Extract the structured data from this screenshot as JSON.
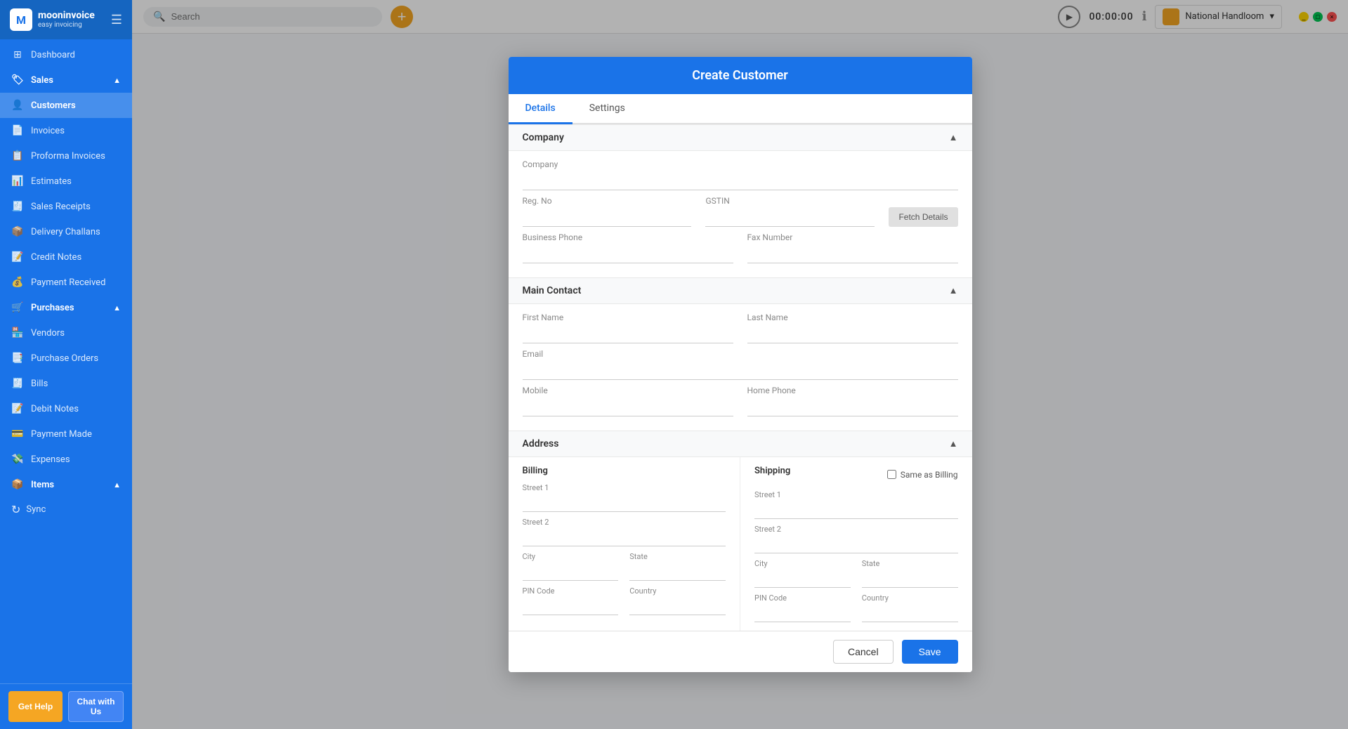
{
  "app": {
    "name": "mooninvoice",
    "tagline": "easy invoicing"
  },
  "topbar": {
    "search_placeholder": "Search",
    "timer": "00:00:00",
    "company": "National Handloom"
  },
  "sidebar": {
    "items": [
      {
        "id": "dashboard",
        "label": "Dashboard",
        "icon": "⊞",
        "active": false,
        "section": false
      },
      {
        "id": "sales",
        "label": "Sales",
        "icon": "🏷",
        "active": false,
        "section": true,
        "expanded": true
      },
      {
        "id": "customers",
        "label": "Customers",
        "icon": "👤",
        "active": true,
        "section": false
      },
      {
        "id": "invoices",
        "label": "Invoices",
        "icon": "📄",
        "active": false,
        "section": false
      },
      {
        "id": "proforma-invoices",
        "label": "Proforma Invoices",
        "icon": "📋",
        "active": false,
        "section": false
      },
      {
        "id": "estimates",
        "label": "Estimates",
        "icon": "📊",
        "active": false,
        "section": false
      },
      {
        "id": "sales-receipts",
        "label": "Sales Receipts",
        "icon": "🧾",
        "active": false,
        "section": false
      },
      {
        "id": "delivery-challans",
        "label": "Delivery Challans",
        "icon": "📦",
        "active": false,
        "section": false
      },
      {
        "id": "credit-notes",
        "label": "Credit Notes",
        "icon": "📝",
        "active": false,
        "section": false
      },
      {
        "id": "payment-received",
        "label": "Payment Received",
        "icon": "💰",
        "active": false,
        "section": false
      },
      {
        "id": "purchases",
        "label": "Purchases",
        "icon": "🛒",
        "active": false,
        "section": true,
        "expanded": true
      },
      {
        "id": "vendors",
        "label": "Vendors",
        "icon": "🏪",
        "active": false,
        "section": false
      },
      {
        "id": "purchase-orders",
        "label": "Purchase Orders",
        "icon": "📑",
        "active": false,
        "section": false
      },
      {
        "id": "bills",
        "label": "Bills",
        "icon": "🧾",
        "active": false,
        "section": false
      },
      {
        "id": "debit-notes",
        "label": "Debit Notes",
        "icon": "📝",
        "active": false,
        "section": false
      },
      {
        "id": "payment-made",
        "label": "Payment Made",
        "icon": "💳",
        "active": false,
        "section": false
      },
      {
        "id": "expenses",
        "label": "Expenses",
        "icon": "💸",
        "active": false,
        "section": false
      },
      {
        "id": "items",
        "label": "Items",
        "icon": "📦",
        "active": false,
        "section": true,
        "expanded": true
      }
    ],
    "bottom": {
      "get_help": "Get Help",
      "chat": "Chat with Us",
      "sync": "Sync"
    }
  },
  "modal": {
    "title": "Create Customer",
    "tabs": [
      {
        "id": "details",
        "label": "Details",
        "active": true
      },
      {
        "id": "settings",
        "label": "Settings",
        "active": false
      }
    ],
    "sections": {
      "company": {
        "title": "Company",
        "fields": {
          "company": {
            "label": "Company",
            "placeholder": ""
          },
          "reg_no": {
            "label": "Reg. No",
            "placeholder": ""
          },
          "gstin": {
            "label": "GSTIN",
            "placeholder": ""
          },
          "business_phone": {
            "label": "Business Phone",
            "placeholder": ""
          },
          "fax_number": {
            "label": "Fax Number",
            "placeholder": ""
          }
        },
        "fetch_btn": "Fetch Details"
      },
      "main_contact": {
        "title": "Main Contact",
        "fields": {
          "first_name": {
            "label": "First Name",
            "placeholder": ""
          },
          "last_name": {
            "label": "Last Name",
            "placeholder": ""
          },
          "email": {
            "label": "Email",
            "placeholder": ""
          },
          "mobile": {
            "label": "Mobile",
            "placeholder": ""
          },
          "home_phone": {
            "label": "Home Phone",
            "placeholder": ""
          }
        }
      },
      "address": {
        "title": "Address",
        "billing": {
          "label": "Billing",
          "street1": {
            "label": "Street 1",
            "placeholder": ""
          },
          "street2": {
            "label": "Street 2",
            "placeholder": ""
          },
          "city": {
            "label": "City",
            "placeholder": ""
          },
          "state": {
            "label": "State",
            "placeholder": ""
          },
          "pin_code": {
            "label": "PIN Code",
            "placeholder": ""
          },
          "country": {
            "label": "Country",
            "placeholder": ""
          }
        },
        "shipping": {
          "label": "Shipping",
          "same_as_billing": "Same as Billing",
          "street1": {
            "label": "Street 1",
            "placeholder": ""
          },
          "street2": {
            "label": "Street 2",
            "placeholder": ""
          },
          "city": {
            "label": "City",
            "placeholder": ""
          },
          "state": {
            "label": "State",
            "placeholder": ""
          },
          "pin_code": {
            "label": "PIN Code",
            "placeholder": ""
          },
          "country": {
            "label": "Country",
            "placeholder": ""
          }
        }
      }
    },
    "footer": {
      "cancel": "Cancel",
      "save": "Save"
    }
  }
}
